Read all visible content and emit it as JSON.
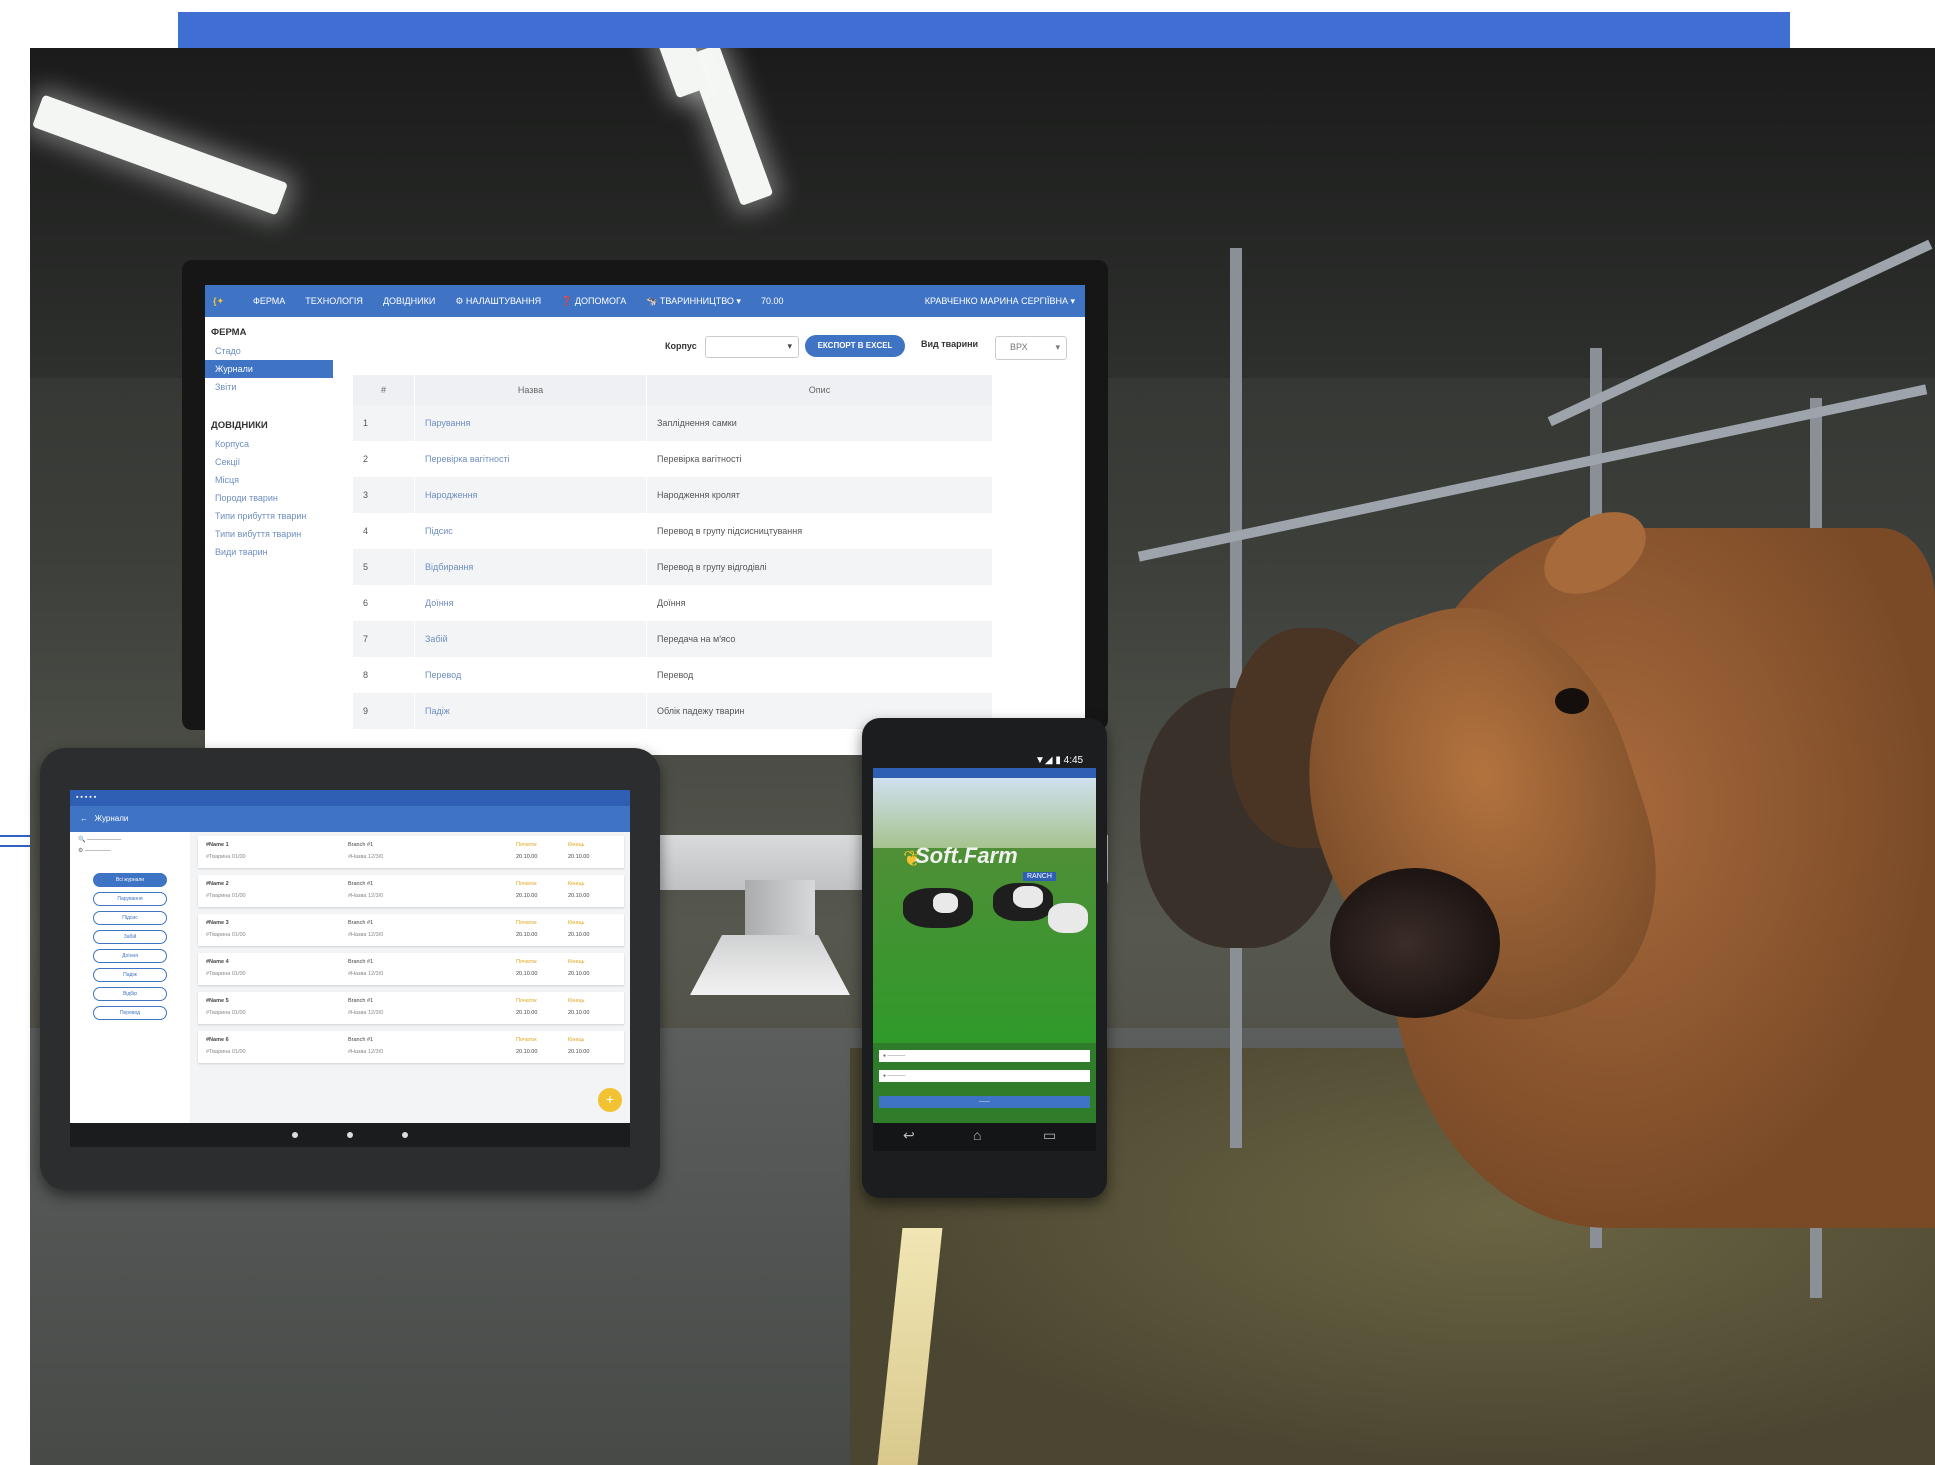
{
  "monitor": {
    "nav": [
      "ФЕРМА",
      "ТЕХНОЛОГІЯ",
      "ДОВІДНИКИ",
      "⚙ НАЛАШТУВАННЯ",
      "❓ ДОПОМОГА",
      "🐄 ТВАРИННИЦТВО ▾",
      "70.00"
    ],
    "user": "КРАВЧЕНКО МАРИНА СЕРГІЇВНА ▾",
    "sidebar": {
      "section1": "ФЕРМА",
      "section1_items": [
        "Стадо",
        "Журнали",
        "Звіти"
      ],
      "section2": "ДОВІДНИКИ",
      "section2_items": [
        "Корпуса",
        "Секції",
        "Місця",
        "Породи тварин",
        "Типи прибуття тварин",
        "Типи вибуття тварин",
        "Види тварин"
      ]
    },
    "filters": {
      "korpus_label": "Корпус",
      "export_button": "ЕКСПОРТ В EXCEL",
      "species_label": "Вид тварини",
      "species_value": "ВРХ"
    },
    "table": {
      "headers": [
        "#",
        "Назва",
        "Опис"
      ],
      "rows": [
        [
          "1",
          "Парування",
          "Запліднення самки"
        ],
        [
          "2",
          "Перевірка вагітності",
          "Перевірка вагітності"
        ],
        [
          "3",
          "Народження",
          "Народження кролят"
        ],
        [
          "4",
          "Підсис",
          "Перевод в групу підсисництування"
        ],
        [
          "5",
          "Відбирання",
          "Перевод в групу відгодівлі"
        ],
        [
          "6",
          "Доїння",
          "Доїння"
        ],
        [
          "7",
          "Забій",
          "Передача на м'ясо"
        ],
        [
          "8",
          "Перевод",
          "Перевод"
        ],
        [
          "9",
          "Падіж",
          "Облік падежу тварин"
        ]
      ]
    }
  },
  "tablet": {
    "title": "Журнали",
    "pills": [
      "Всі журнали",
      "Парування",
      "Підсис",
      "Забій",
      "Доїння",
      "Падіж",
      "Відбір",
      "Перевод"
    ],
    "cards": [
      {
        "name": "#Name 1",
        "sub": "#Тварина 01/00",
        "breed": "Branch #1",
        "bsub": "#Назва 12/3/0",
        "t1": "Початок",
        "v1": "20.10.00",
        "t2": "Кінець",
        "v2": "20.10.00"
      },
      {
        "name": "#Name 2",
        "sub": "#Тварина 01/00",
        "breed": "Branch #1",
        "bsub": "#Назва 12/3/0",
        "t1": "Початок",
        "v1": "20.10.00",
        "t2": "Кінець",
        "v2": "20.10.00"
      },
      {
        "name": "#Name 3",
        "sub": "#Тварина 01/00",
        "breed": "Branch #1",
        "bsub": "#Назва 12/3/0",
        "t1": "Початок",
        "v1": "20.10.00",
        "t2": "Кінець",
        "v2": "20.10.00"
      },
      {
        "name": "#Name 4",
        "sub": "#Тварина 01/00",
        "breed": "Branch #1",
        "bsub": "#Назва 12/3/0",
        "t1": "Початок",
        "v1": "20.10.00",
        "t2": "Кінець",
        "v2": "20.10.00"
      },
      {
        "name": "#Name 5",
        "sub": "#Тварина 01/00",
        "breed": "Branch #1",
        "bsub": "#Назва 12/3/0",
        "t1": "Початок",
        "v1": "20.10.00",
        "t2": "Кінець",
        "v2": "20.10.00"
      },
      {
        "name": "#Name 6",
        "sub": "#Тварина 01/00",
        "breed": "Branch #1",
        "bsub": "#Назва 12/3/0",
        "t1": "Початок",
        "v1": "20.10.00",
        "t2": "Кінець",
        "v2": "20.10.00"
      }
    ]
  },
  "phone": {
    "clock": "▼◢ ▮ 4:45",
    "logo": "Soft.Farm",
    "logo_sub": "RANCH"
  },
  "colors": {
    "brand_blue": "#3f73c4",
    "accent_yellow": "#f1c232"
  }
}
